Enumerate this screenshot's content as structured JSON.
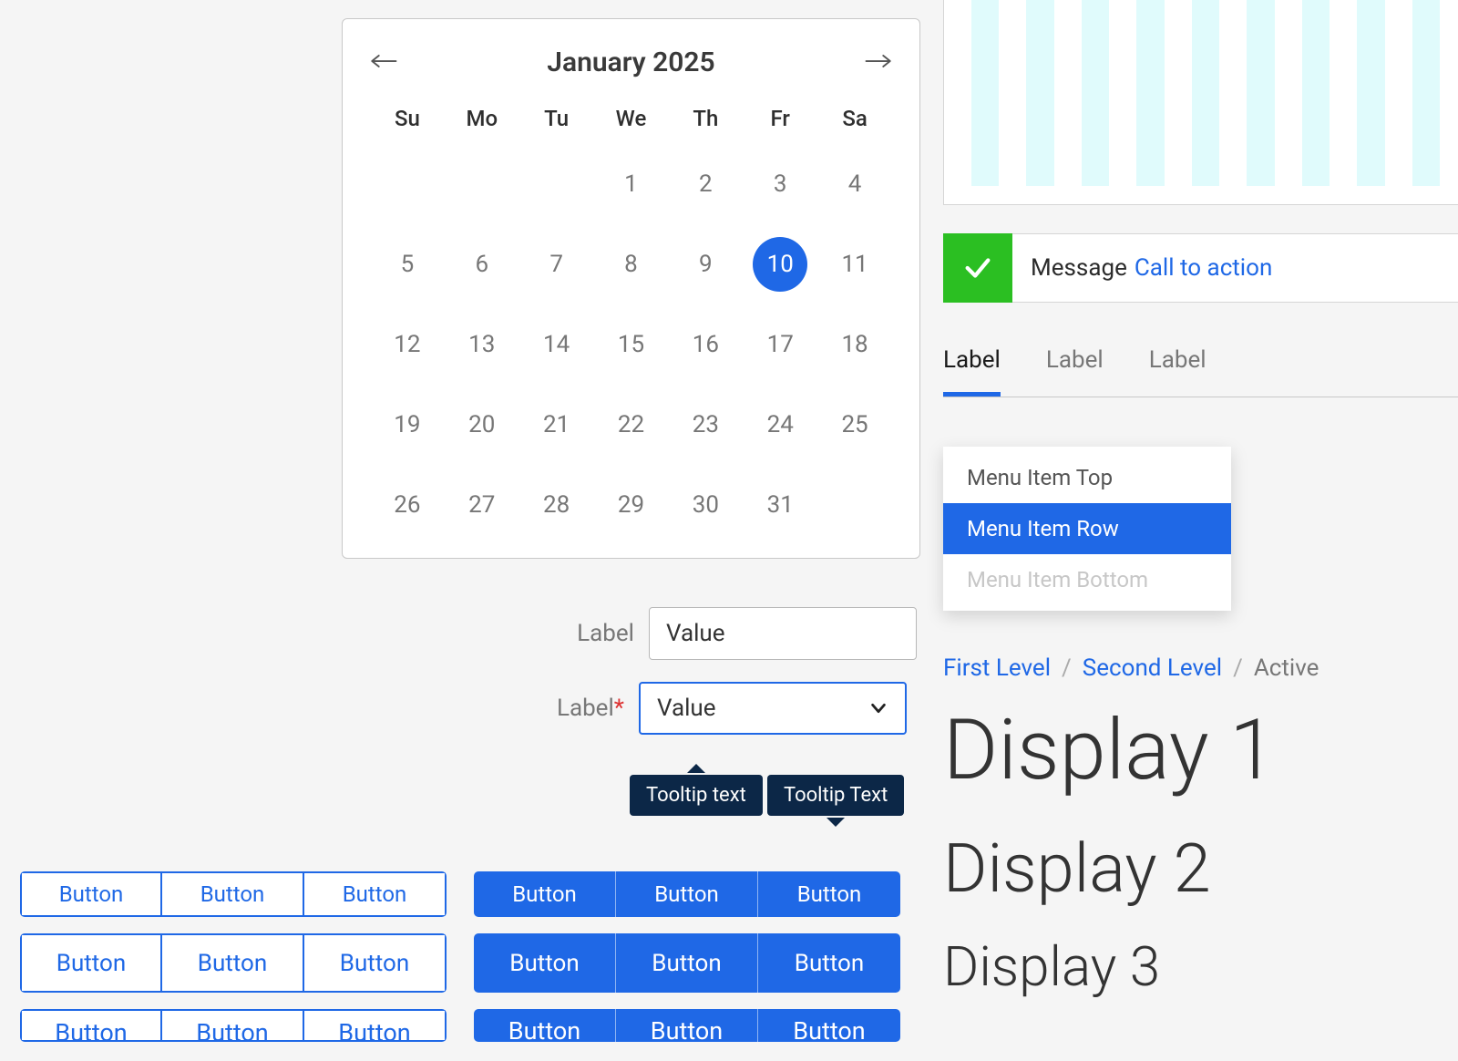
{
  "calendar": {
    "title": "January 2025",
    "dow": [
      "Su",
      "Mo",
      "Tu",
      "We",
      "Th",
      "Fr",
      "Sa"
    ],
    "leading_blanks": 3,
    "days": 31,
    "selected": 10
  },
  "alert": {
    "message": "Message",
    "cta": "Call to action"
  },
  "tabs": [
    "Label",
    "Label",
    "Label"
  ],
  "tabs_active": 0,
  "menu": {
    "top": "Menu Item Top",
    "row": "Menu Item Row",
    "bottom": "Menu Item Bottom"
  },
  "fields": {
    "label1": "Label",
    "value1": "Value",
    "label2": "Label",
    "value2": "Value"
  },
  "tooltips": {
    "a": "Tooltip text",
    "b": "Tooltip Text"
  },
  "button_label": "Button",
  "breadcrumb": {
    "first": "First Level",
    "second": "Second Level",
    "active": "Active"
  },
  "displays": {
    "d1": "Display 1",
    "d2": "Display 2",
    "d3": "Display 3"
  }
}
